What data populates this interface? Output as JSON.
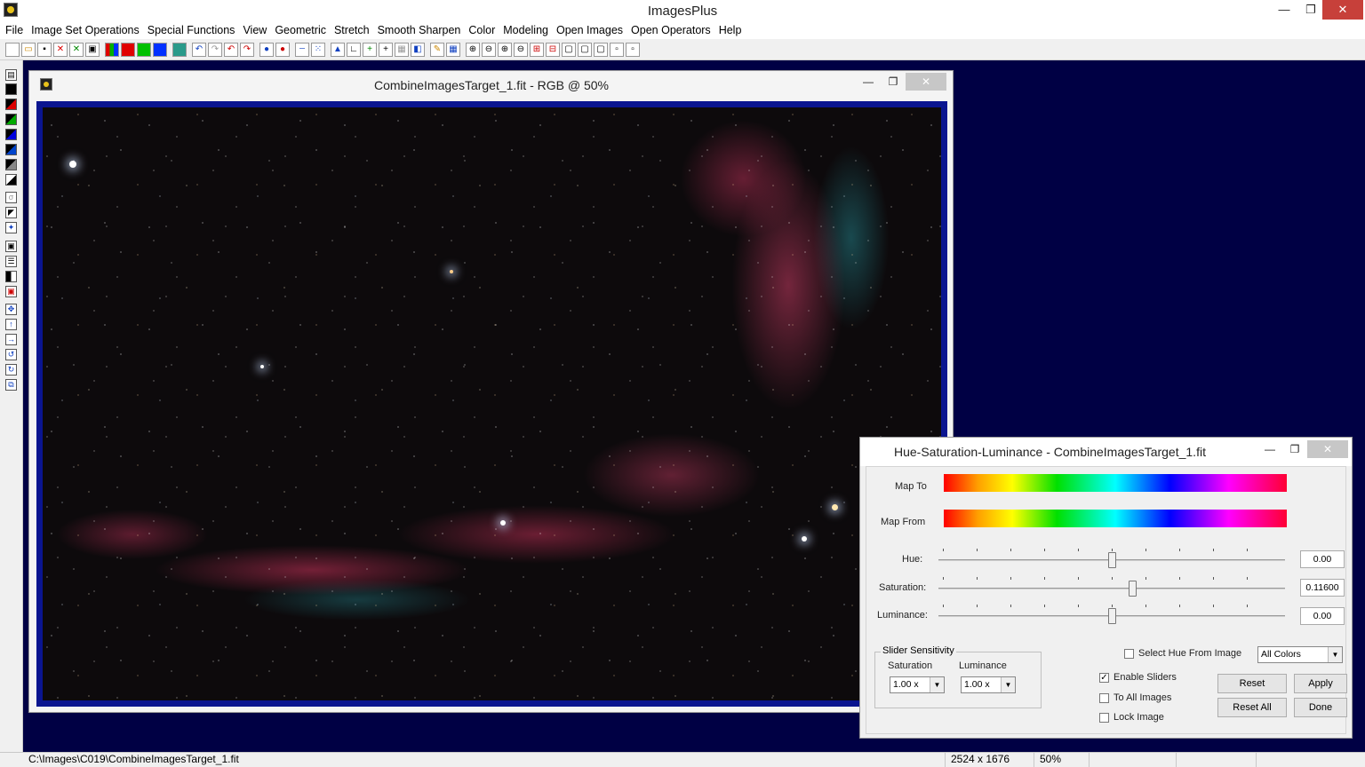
{
  "app": {
    "title": "ImagesPlus"
  },
  "window_controls": {
    "minimize": "—",
    "maximize": "❐",
    "close": "✕"
  },
  "menu": [
    "File",
    "Image Set Operations",
    "Special Functions",
    "View",
    "Geometric",
    "Stretch",
    "Smooth Sharpen",
    "Color",
    "Modeling",
    "Open Images",
    "Open Operators",
    "Help"
  ],
  "image_window": {
    "title": "CombineImagesTarget_1.fit - RGB @ 50%",
    "minimize": "—",
    "maximize": "❐",
    "close": "✕"
  },
  "dialog": {
    "title": "Hue-Saturation-Luminance - CombineImagesTarget_1.fit",
    "minimize": "—",
    "maximize": "❐",
    "close": "✕",
    "map_to_label": "Map To",
    "map_from_label": "Map From",
    "sliders": {
      "hue": {
        "label": "Hue:",
        "value": "0.00",
        "position": 0.5
      },
      "saturation": {
        "label": "Saturation:",
        "value": "0.11600",
        "position": 0.558
      },
      "luminance": {
        "label": "Luminance:",
        "value": "0.00",
        "position": 0.5
      }
    },
    "slider_sensitivity": {
      "legend": "Slider Sensitivity",
      "saturation_label": "Saturation",
      "saturation_value": "1.00 x",
      "luminance_label": "Luminance",
      "luminance_value": "1.00 x"
    },
    "select_hue_from_image": {
      "label": "Select Hue From Image",
      "checked": false
    },
    "colors_select": "All Colors",
    "enable_sliders": {
      "label": "Enable Sliders",
      "checked": true
    },
    "to_all_images": {
      "label": "To All Images",
      "checked": false
    },
    "lock_image": {
      "label": "Lock Image",
      "checked": false
    },
    "buttons": {
      "reset": "Reset",
      "apply": "Apply",
      "reset_all": "Reset All",
      "done": "Done"
    }
  },
  "status": {
    "path": "C:\\Images\\C019\\CombineImagesTarget_1.fit",
    "dimensions": "2524 x 1676",
    "zoom": "50%"
  }
}
